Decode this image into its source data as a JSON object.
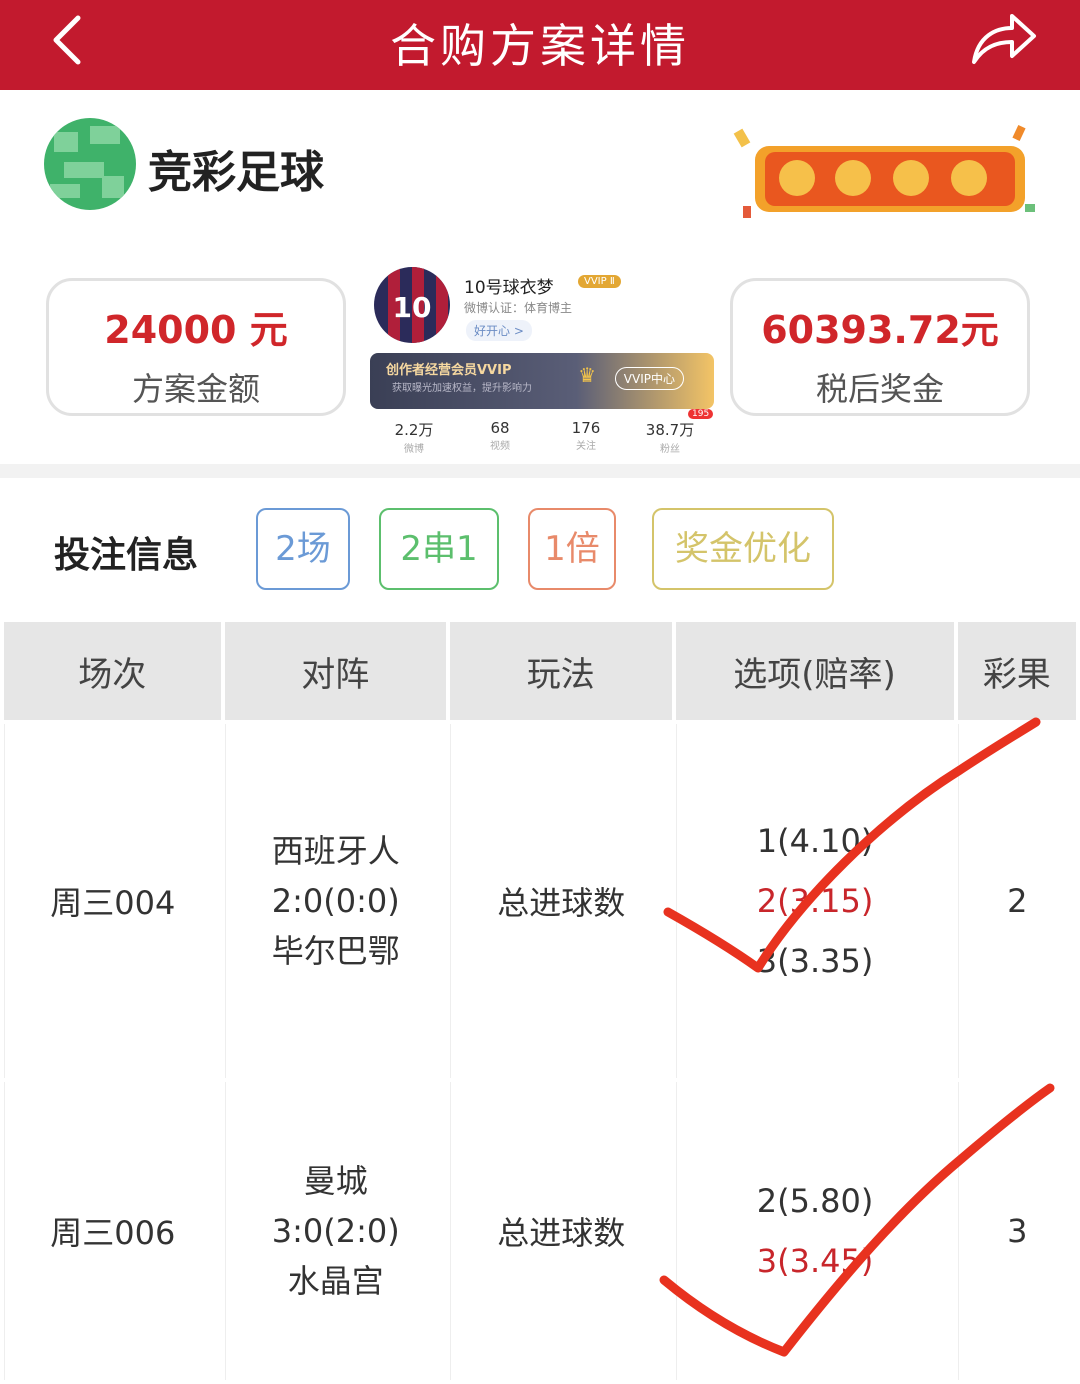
{
  "header": {
    "title": "合购方案详情"
  },
  "brand": {
    "name": "竞彩足球"
  },
  "summary": {
    "plan_amount_value": "24000 元",
    "plan_amount_label": "方案金额",
    "after_tax_prize_value": "60393.72元",
    "after_tax_prize_label": "税后奖金"
  },
  "profile": {
    "name": "10号球衣梦",
    "vip_label": "VVIP Ⅱ",
    "verification": "微博认证：体育博主",
    "mood": "好开心 >",
    "banner_title": "创作者经营会员VVIP",
    "banner_subtitle": "获取曝光加速权益，提升影响力",
    "banner_button": "VVIP中心",
    "notification_count": "195",
    "stats": [
      {
        "value": "2.2万",
        "label": "微博"
      },
      {
        "value": "68",
        "label": "视频"
      },
      {
        "value": "176",
        "label": "关注"
      },
      {
        "value": "38.7万",
        "label": "粉丝"
      }
    ]
  },
  "bet_info": {
    "title": "投注信息",
    "chips": [
      {
        "label": "2场",
        "color": "#6b9ad6"
      },
      {
        "label": "2串1",
        "color": "#5cbf6d"
      },
      {
        "label": "1倍",
        "color": "#e88a6a"
      },
      {
        "label": "奖金优化",
        "color": "#d4c46a"
      }
    ]
  },
  "table": {
    "headers": [
      "场次",
      "对阵",
      "玩法",
      "选项(赔率)",
      "彩果"
    ],
    "rows": [
      {
        "match_no": "周三004",
        "home": "西班牙人",
        "score": "2:0(0:0)",
        "away": "毕尔巴鄂",
        "play": "总进球数",
        "options": [
          {
            "text": "1(4.10)",
            "hit": false
          },
          {
            "text": "2(3.15)",
            "hit": true
          },
          {
            "text": "3(3.35)",
            "hit": false
          }
        ],
        "result": "2"
      },
      {
        "match_no": "周三006",
        "home": "曼城",
        "score": "3:0(2:0)",
        "away": "水晶宫",
        "play": "总进球数",
        "options": [
          {
            "text": "2(5.80)",
            "hit": false
          },
          {
            "text": "3(3.45)",
            "hit": true
          }
        ],
        "result": "3"
      }
    ]
  },
  "colors": {
    "header_bg": "#c21a2e",
    "amount_red": "#d0262a",
    "hit_red": "#c8262b",
    "check_mark": "#e8321f"
  }
}
